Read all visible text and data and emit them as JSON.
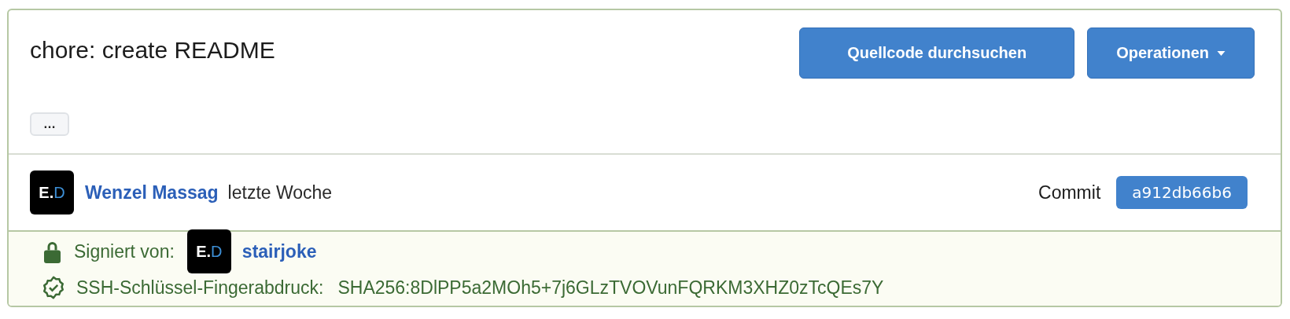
{
  "commit": {
    "title": "chore: create README",
    "more_button": "…",
    "buttons": [
      {
        "label": "Quellcode durchsuchen",
        "kind": "plain"
      },
      {
        "label": "Operationen",
        "kind": "dropdown"
      }
    ],
    "author": {
      "avatar": {
        "initials": "E.",
        "accent": "D"
      },
      "name": "Wenzel Massag",
      "time": "letzte Woche"
    },
    "commit_label": "Commit",
    "sha": "a912db66b6",
    "signature": {
      "label": "Signiert von:",
      "avatar": {
        "initials": "E.",
        "accent": "D"
      },
      "signer": "stairjoke",
      "fingerprint_label": "SSH-Schlüssel-Fingerabdruck:",
      "fingerprint": "SHA256:8DlPP5a2MOh5+7j6GLzTVOVunFQRKM3XHZ0zTcQEs7Y"
    }
  }
}
